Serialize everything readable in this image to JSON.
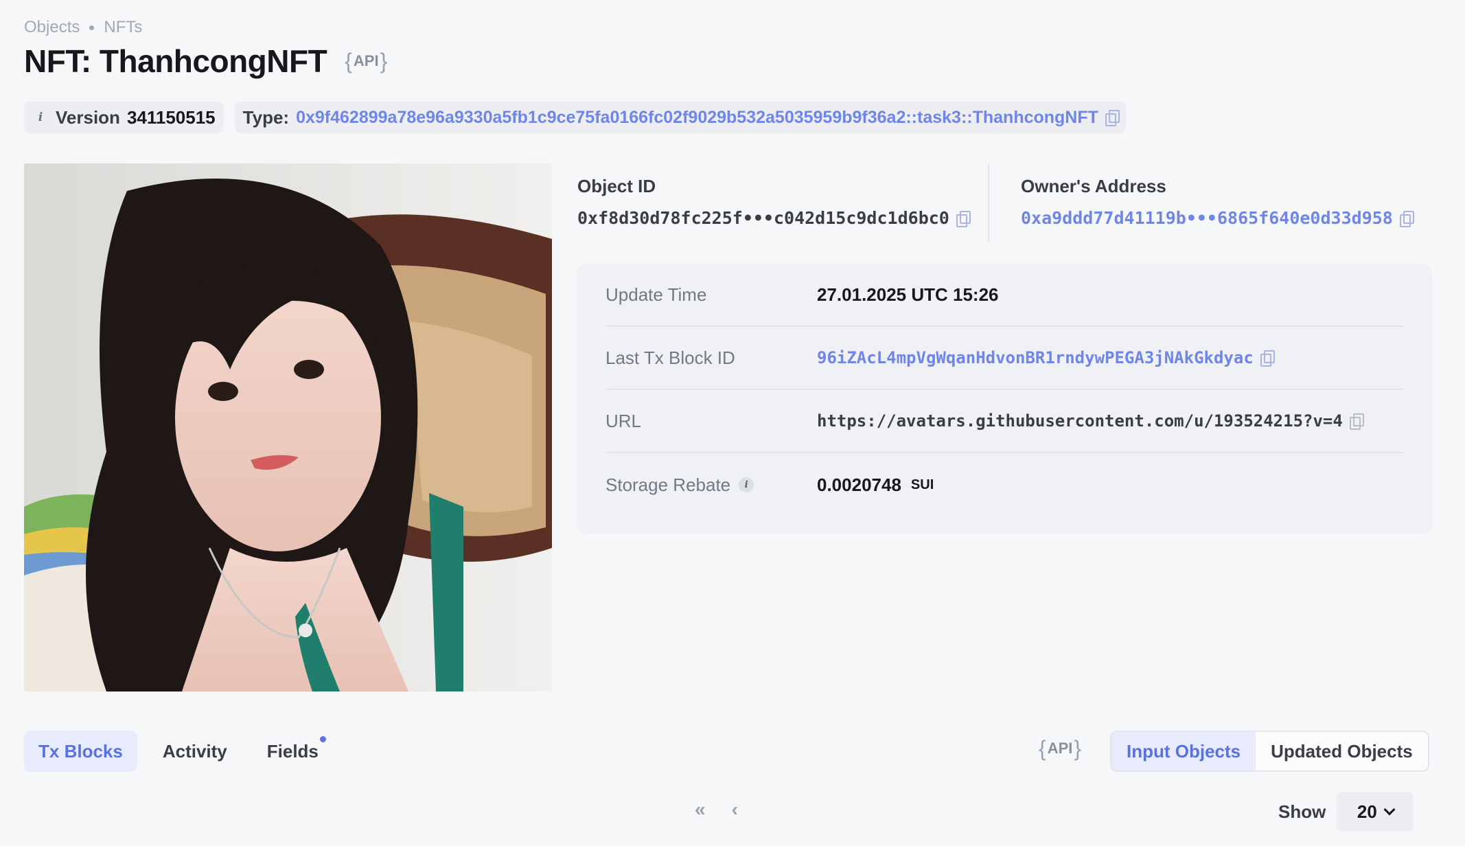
{
  "breadcrumb": [
    "Objects",
    "NFTs"
  ],
  "title": "NFT: ThanhcongNFT",
  "api_label": "API",
  "version": {
    "label": "Version",
    "value": "341150515"
  },
  "type": {
    "label": "Type:",
    "value": "0x9f462899a78e96a9330a5fb1c9ce75fa0166fc02f9029b532a5035959b9f36a2::task3::ThanhcongNFT"
  },
  "object_id": {
    "label": "Object ID",
    "value": "0xf8d30d78fc225f•••c042d15c9dc1d6bc0"
  },
  "owner": {
    "label": "Owner's Address",
    "value": "0xa9ddd77d41119b•••6865f640e0d33d958"
  },
  "details": [
    {
      "key": "Update Time",
      "value": "27.01.2025 UTC 15:26"
    },
    {
      "key": "Last Tx Block ID",
      "value": "96iZAcL4mpVgWqanHdvonBR1rndywPEGA3jNAkGkdyac"
    },
    {
      "key": "URL",
      "value": "https://avatars.githubusercontent.com/u/193524215?v=4"
    },
    {
      "key": "Storage Rebate",
      "value": "0.0020748",
      "unit": "SUI"
    }
  ],
  "tabs": [
    "Tx Blocks",
    "Activity",
    "Fields"
  ],
  "segmented": [
    "Input Objects",
    "Updated Objects"
  ],
  "pagination": {
    "first": "«",
    "prev": "‹",
    "show_label": "Show",
    "page_size": "20"
  },
  "colors": {
    "accent": "#5a72e0",
    "link": "#6f86e6",
    "background": "#f6f7f9"
  }
}
